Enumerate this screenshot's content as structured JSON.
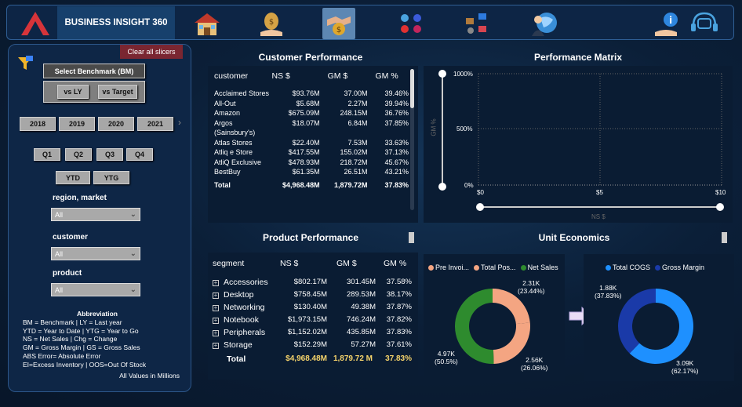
{
  "header": {
    "brand": "BUSINESS INSIGHT 360",
    "nav_icons": [
      "finance-icon",
      "sales-icon",
      "marketing-icon",
      "supply-chain-icon",
      "executive-icon",
      "info-icon",
      "support-icon"
    ]
  },
  "sidebar": {
    "clear_label": "Clear all slicers",
    "benchmark_title": "Select Benchmark (BM)",
    "benchmarks": [
      "vs LY",
      "vs Target"
    ],
    "years": [
      "2018",
      "2019",
      "2020",
      "2021"
    ],
    "quarters": [
      "Q1",
      "Q2",
      "Q3",
      "Q4"
    ],
    "period_types": [
      "YTD",
      "YTG"
    ],
    "region_label": "region, market",
    "region_value": "All",
    "customer_label": "customer",
    "customer_value": "All",
    "product_label": "product",
    "product_value": "All",
    "abbr_title": "Abbreviation",
    "abbr_lines": [
      "BM = Benchmark | LY = Last year",
      "YTD = Year to Date | YTG = Year to Go",
      "NS = Net Sales | Chg = Change",
      "GM = Gross Margin | GS = Gross Sales",
      "ABS Error= Absolute Error",
      "EI=Excess Inventory | OOS=Out Of Stock"
    ],
    "abbr_footer": "All Values in Millions"
  },
  "customer_performance": {
    "title": "Customer Performance",
    "columns": [
      "customer",
      "NS $",
      "GM $",
      "GM %"
    ],
    "rows": [
      [
        "Acclaimed Stores",
        "$93.76M",
        "37.00M",
        "39.46%"
      ],
      [
        "All-Out",
        "$5.68M",
        "2.27M",
        "39.94%"
      ],
      [
        "Amazon",
        "$675.09M",
        "248.15M",
        "36.76%"
      ],
      [
        "Argos (Sainsbury's)",
        "$18.07M",
        "6.84M",
        "37.85%"
      ],
      [
        "Atlas Stores",
        "$22.40M",
        "7.53M",
        "33.63%"
      ],
      [
        "Atliq e Store",
        "$417.55M",
        "155.02M",
        "37.13%"
      ],
      [
        "AtliQ Exclusive",
        "$478.93M",
        "218.72M",
        "45.67%"
      ],
      [
        "BestBuy",
        "$61.35M",
        "26.51M",
        "43.21%"
      ]
    ],
    "total": [
      "Total",
      "$4,968.48M",
      "1,879.72M",
      "37.83%"
    ]
  },
  "performance_matrix": {
    "title": "Performance Matrix",
    "y_ticks": [
      "1000%",
      "500%",
      "0%"
    ],
    "x_ticks": [
      "$0",
      "$5",
      "$10"
    ],
    "ylabel": "GM %",
    "xlabel": "NS $"
  },
  "product_performance": {
    "title": "Product Performance",
    "columns": [
      "segment",
      "NS $",
      "GM $",
      "GM %"
    ],
    "rows": [
      [
        "Accessories",
        "$802.17M",
        "301.45M",
        "37.58%"
      ],
      [
        "Desktop",
        "$758.45M",
        "289.53M",
        "38.17%"
      ],
      [
        "Networking",
        "$130.40M",
        "49.38M",
        "37.87%"
      ],
      [
        "Notebook",
        "$1,973.15M",
        "746.24M",
        "37.82%"
      ],
      [
        "Peripherals",
        "$1,152.02M",
        "435.85M",
        "37.83%"
      ],
      [
        "Storage",
        "$152.29M",
        "57.27M",
        "37.61%"
      ]
    ],
    "total": [
      "Total",
      "$4,968.48M",
      "1,879.72 M",
      "37.83%"
    ]
  },
  "unit_economics": {
    "title": "Unit Economics"
  },
  "chart_data": [
    {
      "type": "pie",
      "donut": true,
      "categories": [
        "Pre Invoi...",
        "Total Pos...",
        "Net Sales"
      ],
      "values": [
        2.31,
        2.56,
        4.97
      ],
      "labels": [
        [
          "2.31K",
          "(23.44%)"
        ],
        [
          "2.56K",
          "(26.06%)"
        ],
        [
          "4.97K",
          "(50.5%)"
        ]
      ],
      "colors": [
        "#f4a582",
        "#f4a582",
        "#2e8b2e"
      ],
      "legend_colors": [
        "#f4a582",
        "#f4a582",
        "#2e8b2e"
      ]
    },
    {
      "type": "pie",
      "donut": true,
      "categories": [
        "Total COGS",
        "Gross Margin"
      ],
      "values": [
        3.09,
        1.88
      ],
      "labels": [
        [
          "3.09K",
          "(62.17%)"
        ],
        [
          "1.88K",
          "(37.83%)"
        ]
      ],
      "colors": [
        "#1e90ff",
        "#1a3aa8"
      ]
    }
  ]
}
